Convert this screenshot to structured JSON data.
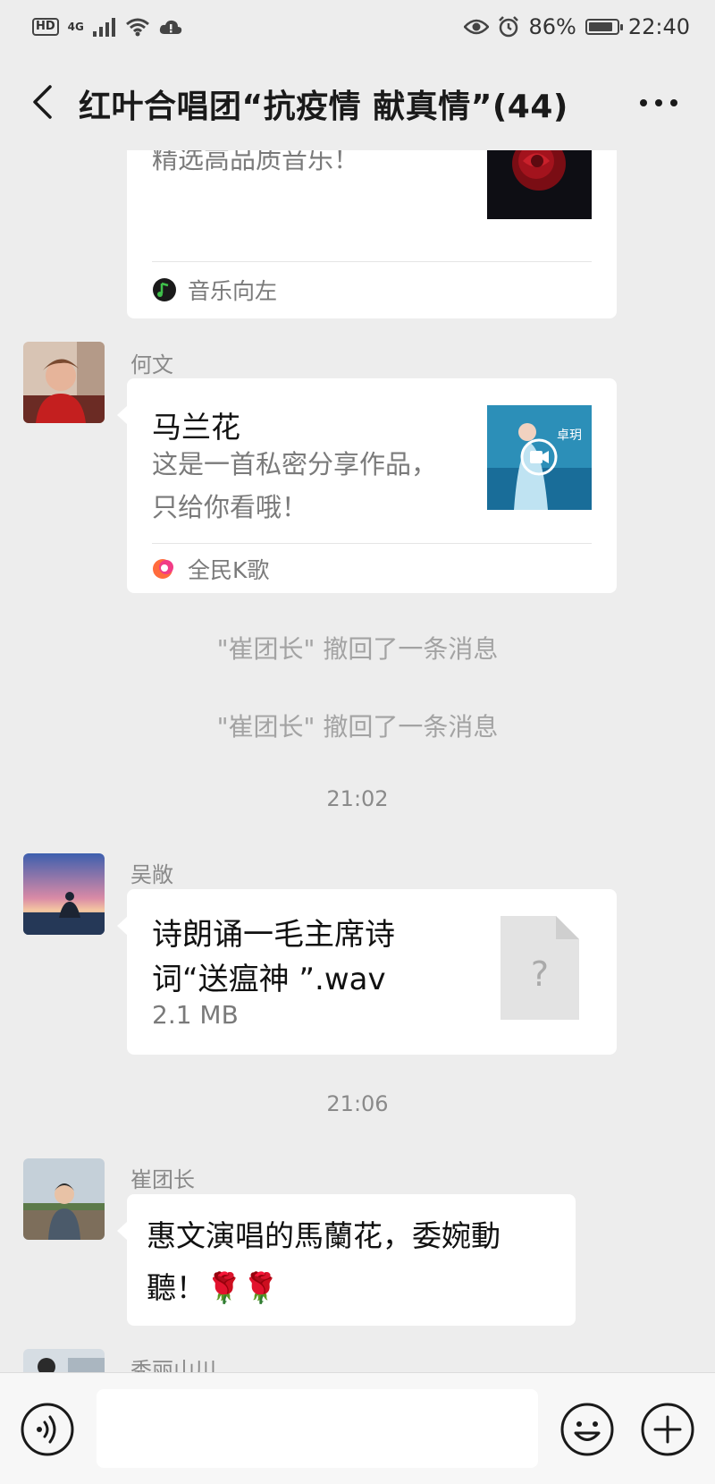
{
  "status_bar": {
    "hd": "HD",
    "network": "4G",
    "battery_percent": "86%",
    "battery_level": 0.86,
    "time": "22:40"
  },
  "header": {
    "title": "红叶合唱团“抗疫情   献真情”(44)"
  },
  "messages": {
    "card1": {
      "desc_tail": "精选高品质音乐！",
      "source": "音乐向左"
    },
    "card2": {
      "sender": "何文",
      "title": "马兰花",
      "desc": "这是一首私密分享作品，只给你看哦！",
      "source": "全民K歌"
    },
    "recall1": "\"崔团长\" 撤回了一条消息",
    "recall2": "\"崔团长\" 撤回了一条消息",
    "time1": "21:02",
    "file_msg": {
      "sender": "吴敞",
      "filename": "诗朗诵一毛主席诗词“送瘟神 ”.wav",
      "size": "2.1 MB"
    },
    "time2": "21:06",
    "text_msg": {
      "sender": "崔团长",
      "text": "惠文演唱的馬蘭花，委婉動聽！🌹🌹"
    },
    "partial_sender": "秀丽山川"
  },
  "input_bar": {
    "placeholder": ""
  },
  "colors": {
    "background": "#ededed",
    "bubble": "#ffffff",
    "muted_text": "#8a8a8a"
  }
}
